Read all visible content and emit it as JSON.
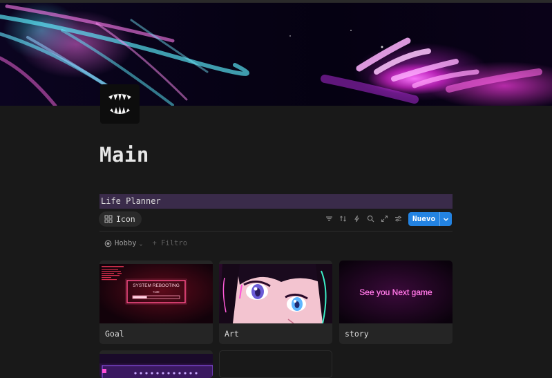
{
  "page": {
    "title": "Main"
  },
  "database": {
    "title": "Life Planner",
    "view_tab": {
      "label": "Icon",
      "icon": "gallery-grid-icon"
    },
    "toolbar": {
      "icons": [
        "filter-icon",
        "sort-icon",
        "automation-lightning-icon",
        "search-icon",
        "expand-icon",
        "settings-sliders-icon"
      ],
      "new_button_label": "Nuevo"
    },
    "filters": {
      "active": {
        "label": "Hobby",
        "icon": "status-circle-icon"
      },
      "add_label": "+ Filtro"
    }
  },
  "cards": [
    {
      "name": "Goal",
      "thumb_text": "SYSTEM REBOOTING",
      "thumb_percent": "%30",
      "progress": 0.3
    },
    {
      "name": "Art"
    },
    {
      "name": "story",
      "thumb_text": "See you Next game"
    },
    {
      "name": ""
    },
    {
      "name": ""
    }
  ],
  "colors": {
    "background": "#191919",
    "accent_blue": "#2383e2",
    "db_title_bg": "#3a2b4a",
    "neon_pink": "#ff4fd8",
    "neon_cyan": "#55e6ff"
  }
}
